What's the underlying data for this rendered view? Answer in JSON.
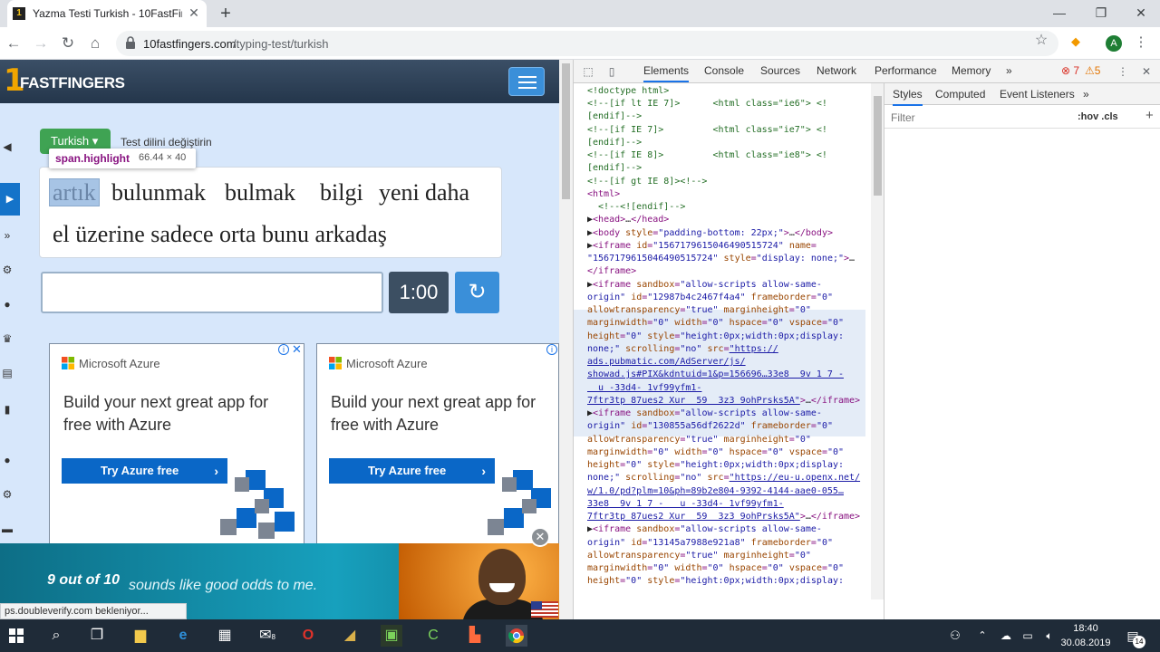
{
  "browser": {
    "tab_title": "Yazma Testi Turkish - 10FastFinge",
    "url_host": "10fastfingers.com",
    "url_path": "/typing-test/turkish",
    "avatar_letter": "A"
  },
  "site": {
    "logo_text": "FASTFINGERS",
    "logo_prefix": "1",
    "language_button": "Turkish ▾",
    "language_hint": "Test dilini değiştirin",
    "tooltip_element": "span.highlight",
    "tooltip_size": "66.44 × 40",
    "words_line1": [
      "artık",
      "bulunmak",
      "bulmak",
      "bilgi",
      "yeni",
      "daha"
    ],
    "words_line2": "el üzerine sadece orta bunu arkadaş",
    "timer": "1:00",
    "reload_icon": "↻"
  },
  "ads": [
    {
      "brand": "Microsoft Azure",
      "headline": "Build your next great app for free with Azure",
      "cta": "Try Azure free"
    },
    {
      "brand": "Microsoft Azure",
      "headline": "Build your next great app for free with Azure",
      "cta": "Try Azure free"
    }
  ],
  "banner": {
    "highlight": "9 out of 10",
    "text": "sounds like good odds to me."
  },
  "status_text": "ps.doubleverify.com bekleniyor...",
  "devtools": {
    "tabs": [
      "Elements",
      "Console",
      "Sources",
      "Network",
      "Performance",
      "Memory"
    ],
    "more_tabs": "»",
    "errors": "7",
    "warnings": "5",
    "styles_tabs": [
      "Styles",
      "Computed",
      "Event Listeners"
    ],
    "filter_placeholder": "Filter",
    "filter_hov": ":hov",
    "filter_cls": ".cls",
    "filter_plus": "+"
  },
  "taskbar": {
    "time": "18:40",
    "date": "30.08.2019",
    "notifications": "14",
    "mail_badge": "8"
  },
  "colors": {
    "chrome_tabbar": "#dee1e6",
    "site_header": "#24364b",
    "language_green": "#3fa353",
    "timer_bg": "#3c4f62",
    "reload_blue": "#3a8fd9",
    "azure_blue": "#0a67c7",
    "taskbar": "#1f2b38"
  }
}
